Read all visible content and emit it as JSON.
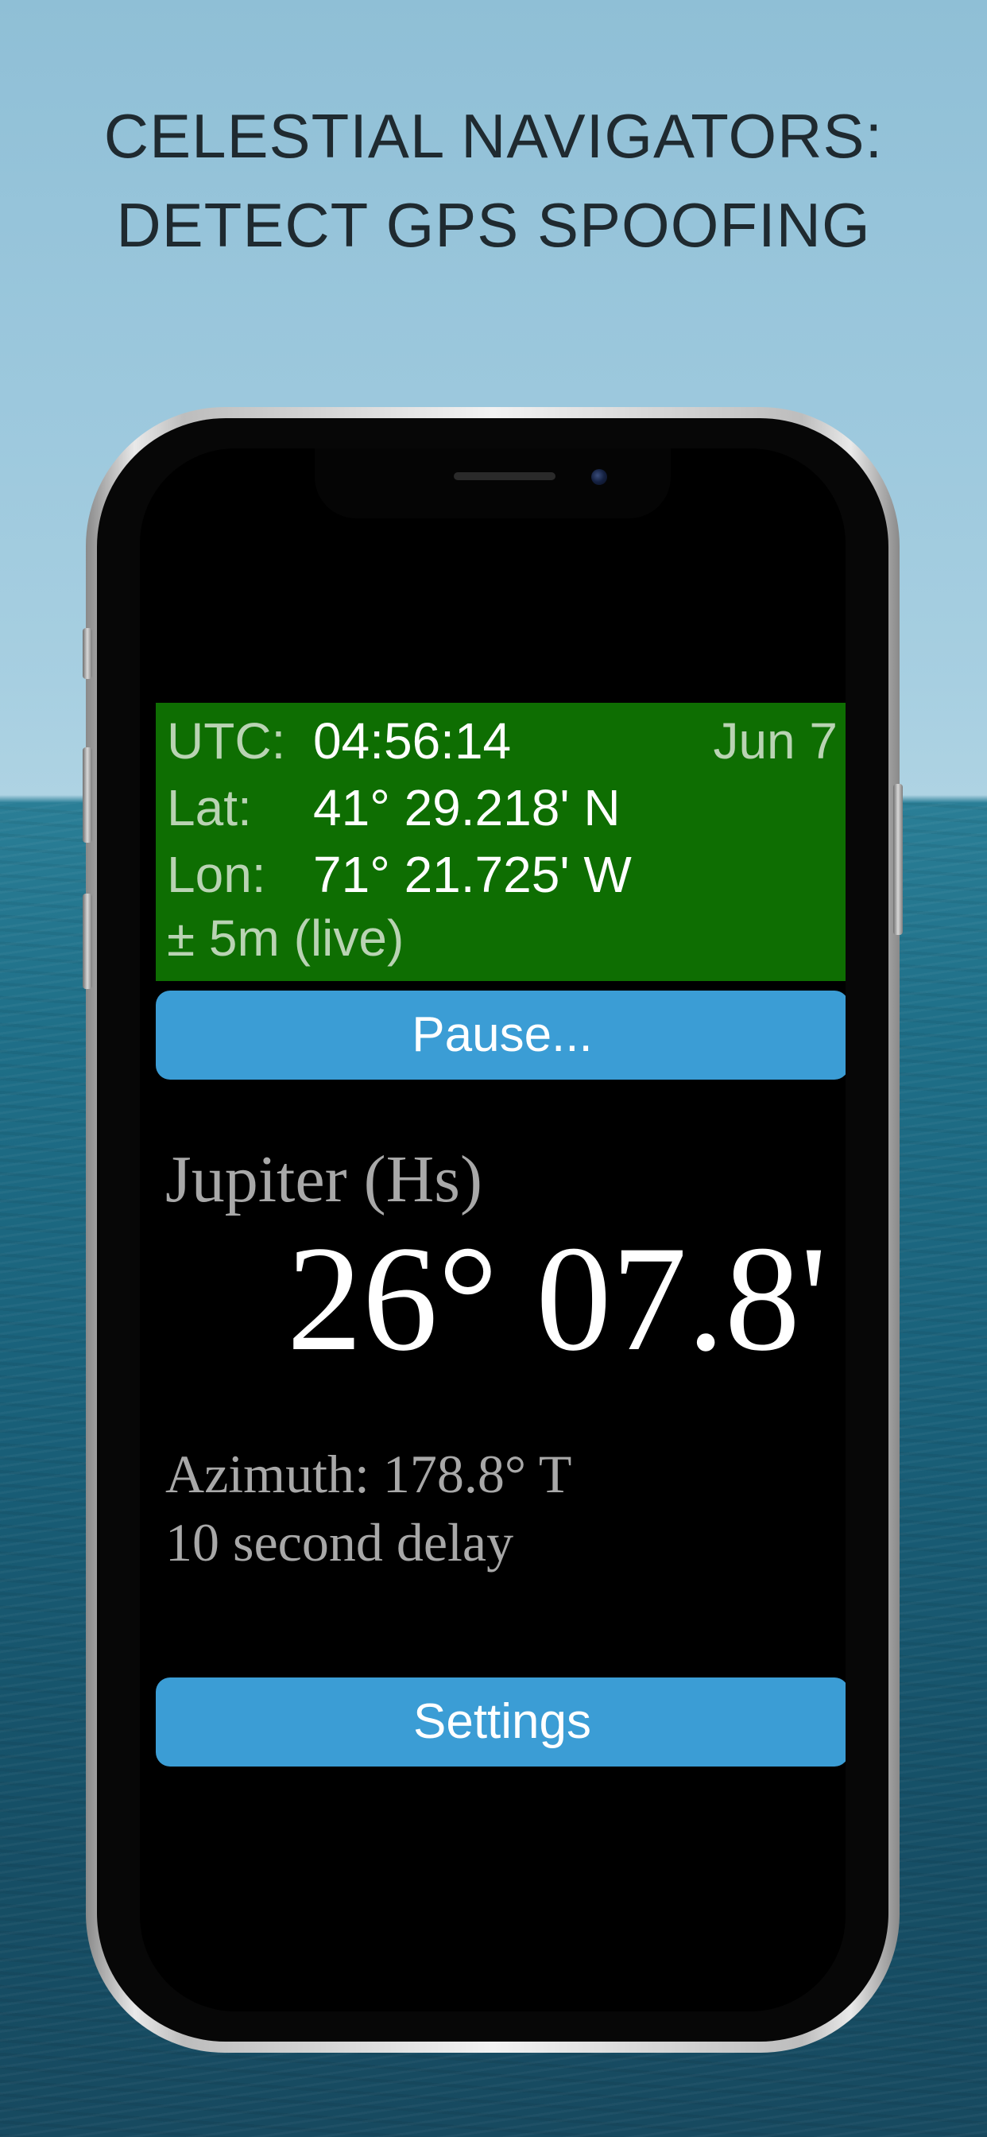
{
  "headline": {
    "line1": "CELESTIAL NAVIGATORS:",
    "line2": "DETECT GPS SPOOFING"
  },
  "app": {
    "utc_label": "UTC:",
    "utc_value": "04:56:14",
    "date": "Jun 7",
    "lat_label": "Lat:",
    "lat_value": "41° 29.218' N",
    "lon_label": "Lon:",
    "lon_value": "71° 21.725' W",
    "accuracy": "± 5m (live)",
    "pause_button": "Pause...",
    "body_name": "Jupiter (Hs)",
    "altitude": "26° 07.8'",
    "azimuth": "Azimuth:  178.8° T",
    "delay": "10 second delay",
    "settings_button": "Settings"
  },
  "colors": {
    "status_panel": "#0e6e02",
    "button": "#3b9dd5",
    "screen": "#000000"
  }
}
